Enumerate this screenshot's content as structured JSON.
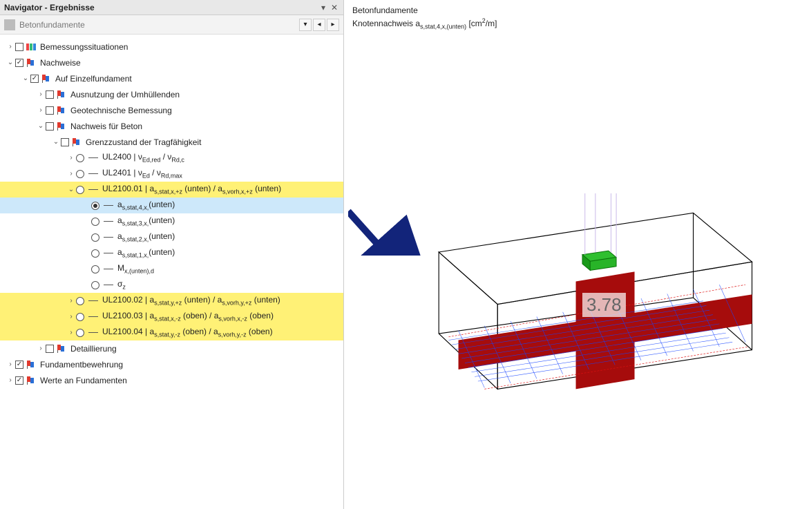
{
  "navigator": {
    "title": "Navigator - Ergebnisse",
    "toolbar_label": "Betonfundamente"
  },
  "tree": [
    {
      "depth": 0,
      "tw": "closed",
      "ctrl": "check",
      "on": false,
      "icon": "color",
      "label": "Bemessungssituationen"
    },
    {
      "depth": 0,
      "tw": "open",
      "ctrl": "check",
      "on": true,
      "icon": "flag",
      "label": "Nachweise"
    },
    {
      "depth": 1,
      "tw": "open",
      "ctrl": "check",
      "on": true,
      "icon": "flag",
      "label": "Auf Einzelfundament"
    },
    {
      "depth": 2,
      "tw": "closed",
      "ctrl": "check",
      "on": false,
      "icon": "flag",
      "label": "Ausnutzung der Umhüllenden"
    },
    {
      "depth": 2,
      "tw": "closed",
      "ctrl": "check",
      "on": false,
      "icon": "flag",
      "label": "Geotechnische Bemessung"
    },
    {
      "depth": 2,
      "tw": "open",
      "ctrl": "check",
      "on": false,
      "icon": "flag",
      "label": "Nachweis für Beton"
    },
    {
      "depth": 3,
      "tw": "open",
      "ctrl": "check",
      "on": false,
      "icon": "flag",
      "label": "Grenzzustand der Tragfähigkeit"
    },
    {
      "depth": 4,
      "tw": "closed",
      "ctrl": "radio",
      "on": false,
      "icon": "dash",
      "html": "UL2400 | ν<sub>Ed,red</sub> / ν<sub>Rd,c</sub>"
    },
    {
      "depth": 4,
      "tw": "closed",
      "ctrl": "radio",
      "on": false,
      "icon": "dash",
      "html": "UL2401 | ν<sub>Ed</sub> / ν<sub>Rd,max</sub>"
    },
    {
      "depth": 4,
      "tw": "open",
      "ctrl": "radio",
      "on": false,
      "icon": "dash",
      "hl": true,
      "html": "UL2100.01 | a<sub>s,stat,x,+z</sub> (unten) / a<sub>s,vorh,x,+z</sub> (unten)"
    },
    {
      "depth": 5,
      "tw": "none",
      "ctrl": "radio",
      "on": true,
      "icon": "dash",
      "sel": true,
      "html": "a<sub>s,stat,4,x,</sub>(unten)"
    },
    {
      "depth": 5,
      "tw": "none",
      "ctrl": "radio",
      "on": false,
      "icon": "dash",
      "html": "a<sub>s,stat,3,x,</sub>(unten)"
    },
    {
      "depth": 5,
      "tw": "none",
      "ctrl": "radio",
      "on": false,
      "icon": "dash",
      "html": "a<sub>s,stat,2,x,</sub>(unten)"
    },
    {
      "depth": 5,
      "tw": "none",
      "ctrl": "radio",
      "on": false,
      "icon": "dash",
      "html": "a<sub>s,stat,1,x,</sub>(unten)"
    },
    {
      "depth": 5,
      "tw": "none",
      "ctrl": "radio",
      "on": false,
      "icon": "dash",
      "html": "M<sub>x,(unten),d</sub>"
    },
    {
      "depth": 5,
      "tw": "none",
      "ctrl": "radio",
      "on": false,
      "icon": "dash",
      "html": "σ<sub>z</sub>"
    },
    {
      "depth": 4,
      "tw": "closed",
      "ctrl": "radio",
      "on": false,
      "icon": "dash",
      "hl": true,
      "html": "UL2100.02 | a<sub>s,stat,y,+z</sub> (unten) / a<sub>s,vorh,y,+z</sub> (unten)"
    },
    {
      "depth": 4,
      "tw": "closed",
      "ctrl": "radio",
      "on": false,
      "icon": "dash",
      "hl": true,
      "html": "UL2100.03 | a<sub>s,stat,x,-z</sub> (oben) / a<sub>s,vorh,x,-z</sub> (oben)"
    },
    {
      "depth": 4,
      "tw": "closed",
      "ctrl": "radio",
      "on": false,
      "icon": "dash",
      "hl": true,
      "html": "UL2100.04 | a<sub>s,stat,y,-z</sub> (oben) / a<sub>s,vorh,y,-z</sub> (oben)"
    },
    {
      "depth": 2,
      "tw": "closed",
      "ctrl": "check",
      "on": false,
      "icon": "flag",
      "label": "Detaillierung"
    },
    {
      "depth": 0,
      "tw": "closed",
      "ctrl": "check",
      "on": true,
      "icon": "flag",
      "label": "Fundamentbewehrung"
    },
    {
      "depth": 0,
      "tw": "closed",
      "ctrl": "check",
      "on": true,
      "icon": "flag",
      "label": "Werte an Fundamenten"
    }
  ],
  "view": {
    "title": "Betonfundamente",
    "subtitle_html": "Knotennachweis a<sub>s,stat,4,x,(unten)</sub> [cm<sup>2</sup>/m]",
    "value": "3.78"
  }
}
